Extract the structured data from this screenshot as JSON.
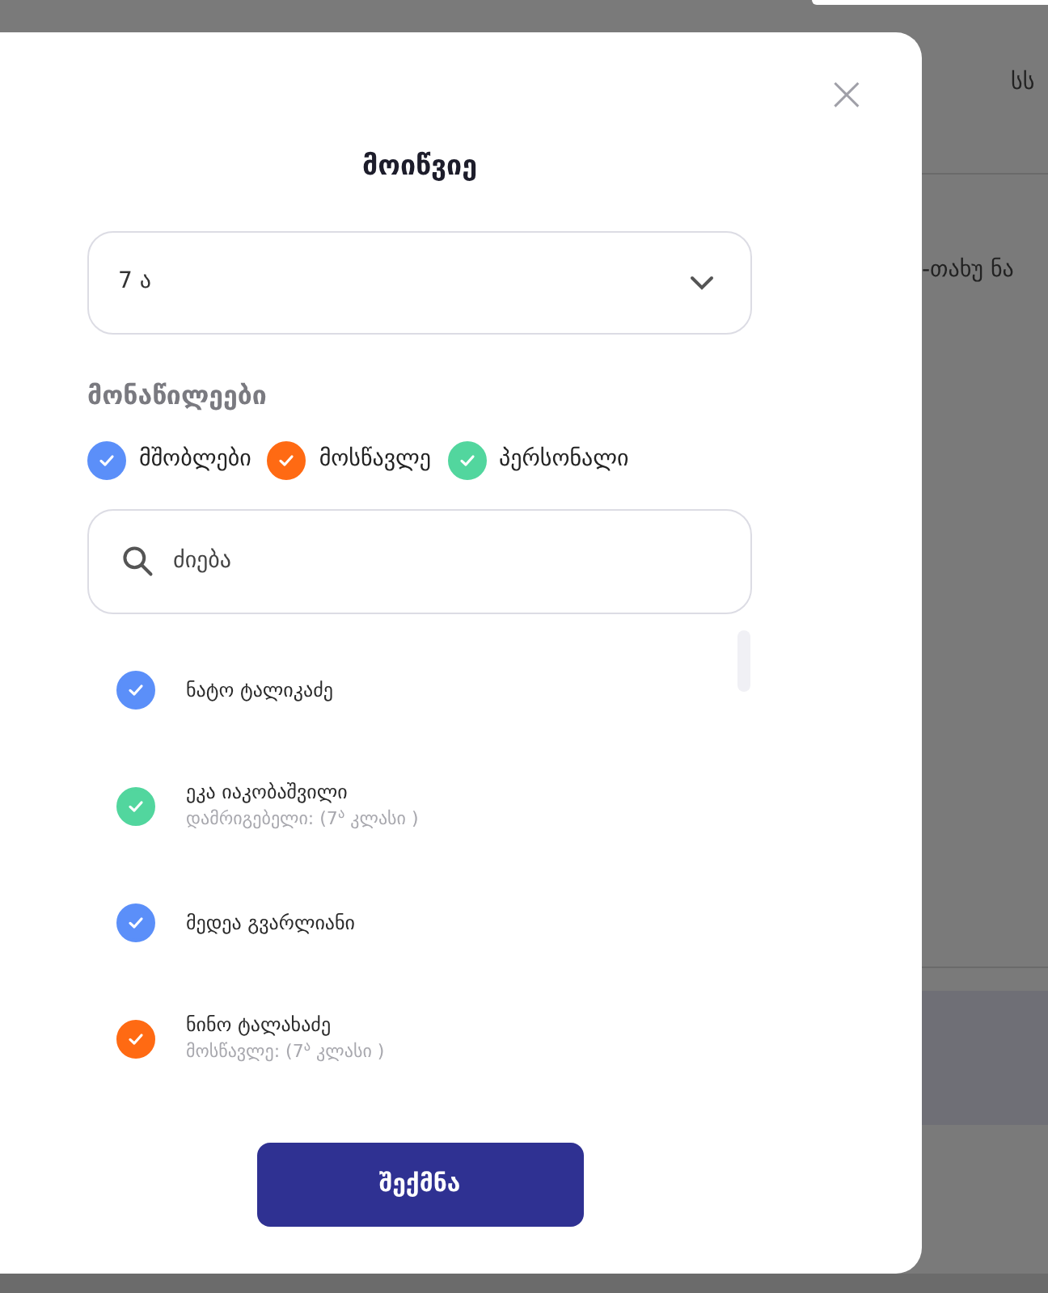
{
  "background_page": {
    "header_text": "სს",
    "row_text": "-თახუ ნა"
  },
  "dialog": {
    "title": "მოიწვიე",
    "close": "×",
    "class_select": {
      "value": "7 ა"
    },
    "participants_label": "მონაწილეები",
    "filters": [
      {
        "label": "მშობლები",
        "checked": true,
        "color": "#5b8ff9"
      },
      {
        "label": "მოსწავლე",
        "checked": true,
        "color": "#ff6a13"
      },
      {
        "label": "პერსონალი",
        "checked": true,
        "color": "#52d69e"
      }
    ],
    "search": {
      "placeholder": "ძიება"
    },
    "people": [
      {
        "name": "ნატო ტალიკაძე",
        "checked": true,
        "color": "#5b8ff9"
      },
      {
        "name": "ეკა იაკობაშვილი",
        "role": "დამრიგებელი: (7$^{ა}$ კლასი )",
        "checked": true,
        "color": "#52d69e"
      },
      {
        "name": "მედეა გვარლიანი",
        "checked": true,
        "color": "#5b8ff9"
      },
      {
        "name": "ნინო ტალახაძე",
        "role": "მოსწავლე: (7$^{ა}$ კლასი )",
        "checked": true,
        "color": "#ff6a13"
      }
    ],
    "create_button": "შექმნა"
  }
}
